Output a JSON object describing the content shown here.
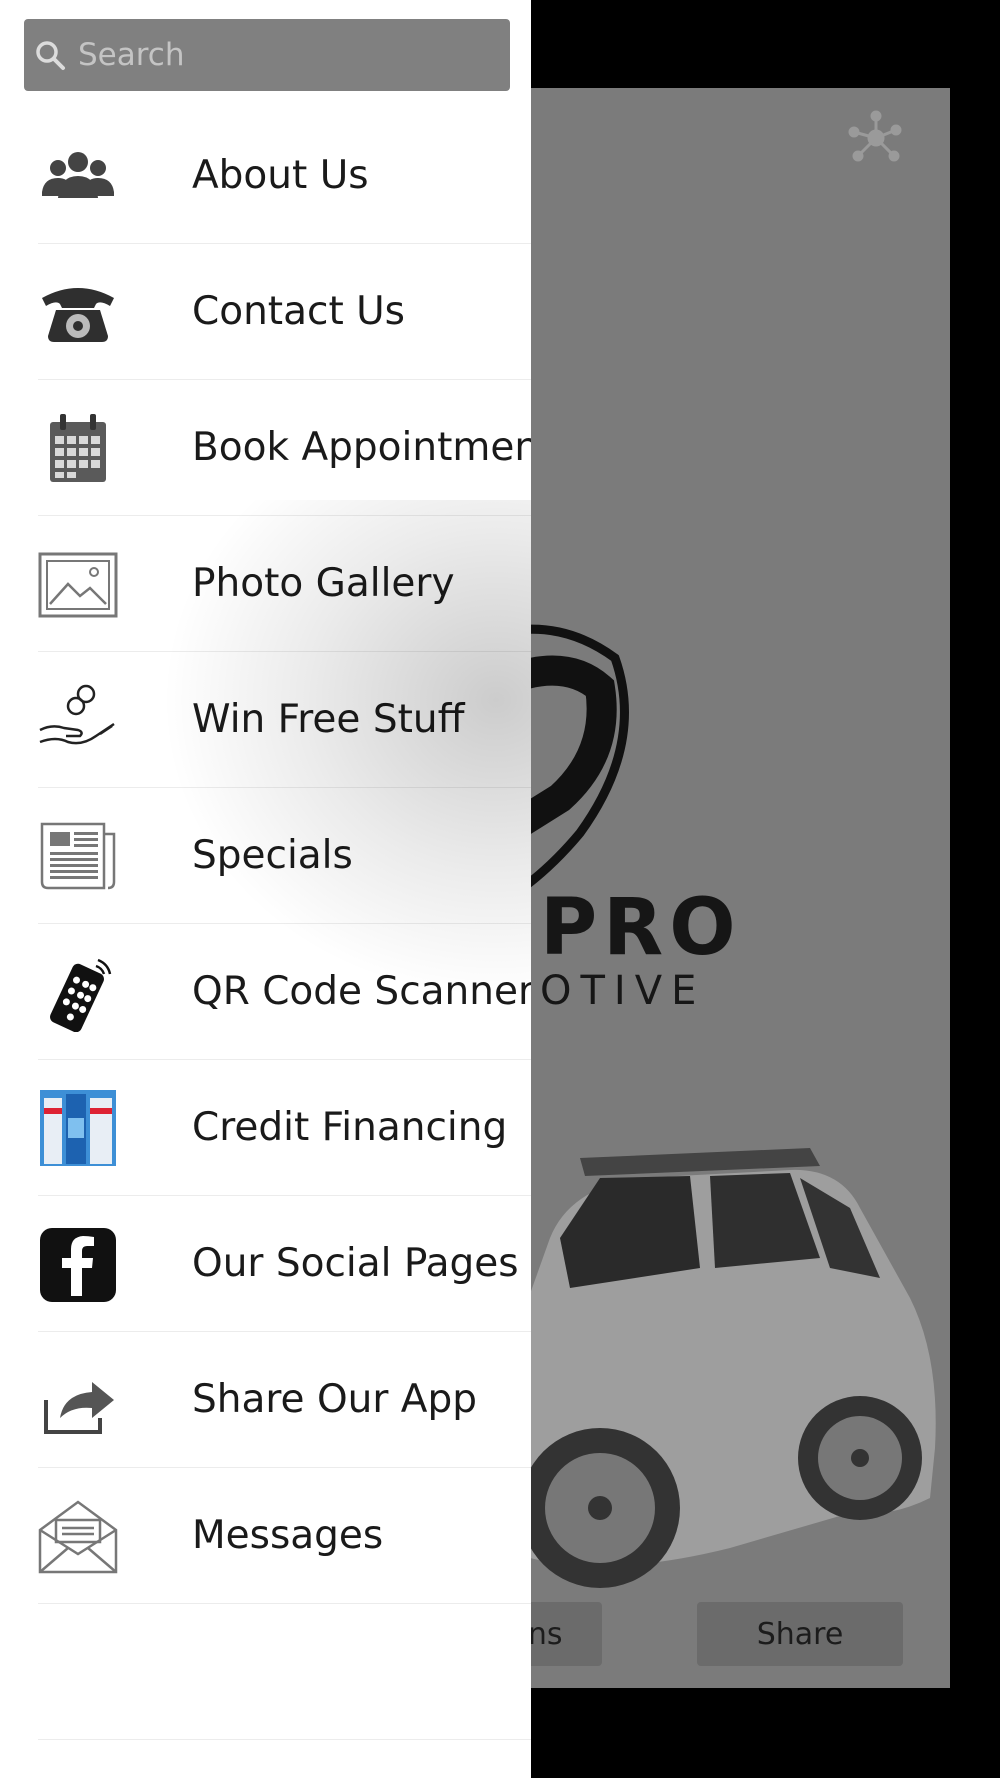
{
  "search": {
    "placeholder": "Search",
    "value": ""
  },
  "menu": {
    "items": [
      {
        "label": "About Us",
        "icon": "people-icon"
      },
      {
        "label": "Contact Us",
        "icon": "telephone-icon"
      },
      {
        "label": "Book Appointment",
        "icon": "calendar-icon"
      },
      {
        "label": "Photo Gallery",
        "icon": "image-icon"
      },
      {
        "label": "Win Free Stuff",
        "icon": "hand-coins-icon"
      },
      {
        "label": "Specials",
        "icon": "newspaper-icon"
      },
      {
        "label": "QR Code Scanner",
        "icon": "remote-icon"
      },
      {
        "label": "Credit Financing",
        "icon": "products-icon"
      },
      {
        "label": "Our Social Pages",
        "icon": "facebook-icon"
      },
      {
        "label": "Share Our App",
        "icon": "share-icon"
      },
      {
        "label": "Messages",
        "icon": "envelope-icon"
      }
    ]
  },
  "background_app": {
    "brand_line1": "PRO",
    "brand_line2": "OTIVE",
    "buttons": {
      "options_label": "ons",
      "share_label": "Share"
    }
  },
  "colors": {
    "search_bg": "#808080",
    "card_bg": "#7b7b7b",
    "drawer_bg": "#ffffff"
  }
}
